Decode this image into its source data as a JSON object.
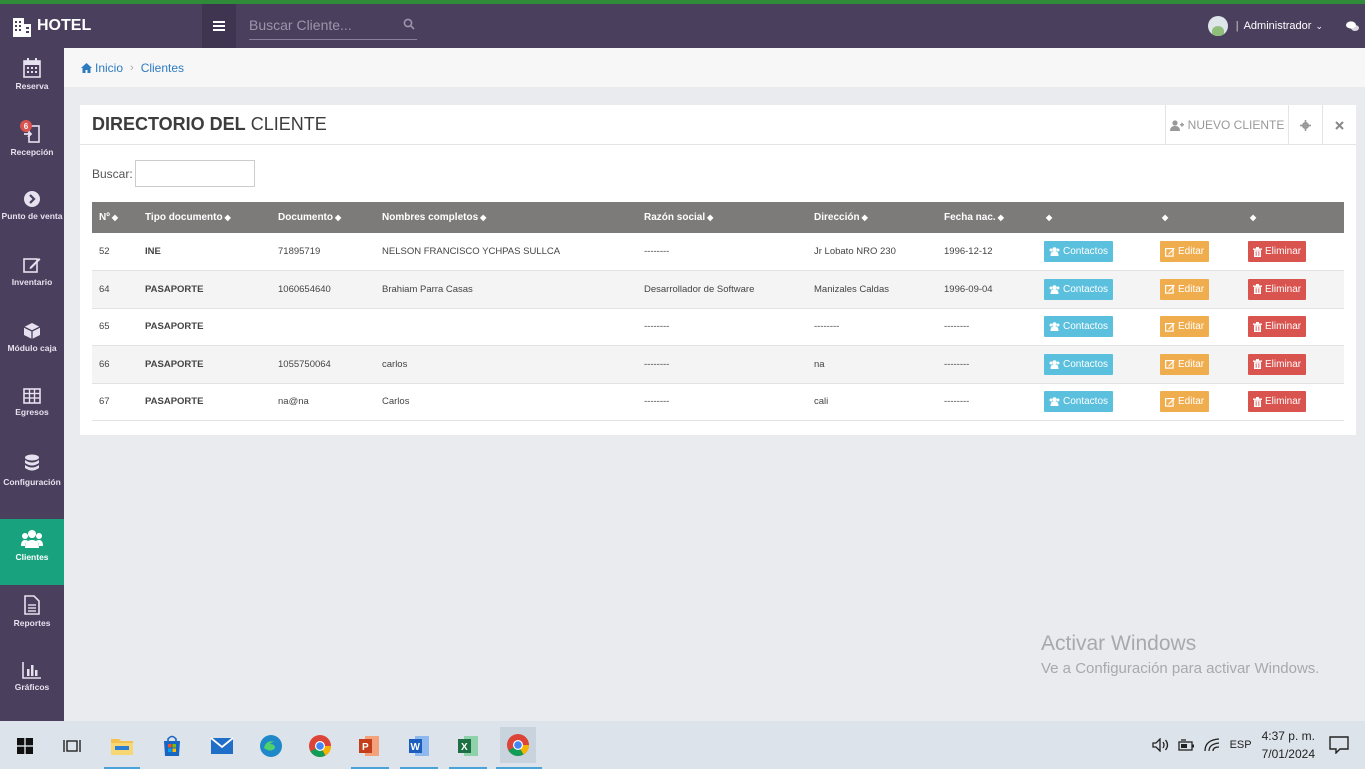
{
  "app": {
    "brand": "HOTEL"
  },
  "topbar": {
    "search_placeholder": "Buscar Cliente...",
    "user_name": "Administrador"
  },
  "sidebar": {
    "items": [
      {
        "label": "Reserva",
        "icon": "calendar-icon"
      },
      {
        "label": "Recepción",
        "icon": "door-icon",
        "badge": "6"
      },
      {
        "label": "Punto de venta",
        "icon": "arrow-circle-icon"
      },
      {
        "label": "Inventario",
        "icon": "edit-icon"
      },
      {
        "label": "Módulo caja",
        "icon": "cube-icon"
      },
      {
        "label": "Egresos",
        "icon": "table-icon"
      },
      {
        "label": "Configuración",
        "icon": "database-icon"
      },
      {
        "label": "Clientes",
        "icon": "users-icon",
        "active": true
      },
      {
        "label": "Reportes",
        "icon": "file-icon"
      },
      {
        "label": "Gráficos",
        "icon": "bar-chart-icon"
      }
    ]
  },
  "breadcrumb": {
    "home": "Inicio",
    "current": "Clientes"
  },
  "panel": {
    "title_bold": "DIRECTORIO DEL",
    "title_rest": " CLIENTE",
    "new_button": "NUEVO CLIENTE",
    "search_label": "Buscar:"
  },
  "table": {
    "headers": [
      "Nº",
      "Tipo documento",
      "Documento",
      "Nombres completos",
      "Razón social",
      "Dirección",
      "Fecha nac.",
      "",
      "",
      ""
    ],
    "rows": [
      {
        "n": "52",
        "tipo": "INE",
        "doc": "71895719",
        "nombre": "NELSON FRANCISCO YCHPAS SULLCA",
        "razon": "--------",
        "dir": "Jr Lobato NRO 230",
        "fecha": "1996-12-12"
      },
      {
        "n": "64",
        "tipo": "PASAPORTE",
        "doc": "1060654640",
        "nombre": "Brahiam Parra Casas",
        "razon": "Desarrollador de Software",
        "dir": "Manizales Caldas",
        "fecha": "1996-09-04"
      },
      {
        "n": "65",
        "tipo": "PASAPORTE",
        "doc": "",
        "nombre": "",
        "razon": "--------",
        "dir": "--------",
        "fecha": "--------"
      },
      {
        "n": "66",
        "tipo": "PASAPORTE",
        "doc": "1055750064",
        "nombre": "carlos",
        "razon": "--------",
        "dir": "na",
        "fecha": "--------"
      },
      {
        "n": "67",
        "tipo": "PASAPORTE",
        "doc": "na@na",
        "nombre": "Carlos",
        "razon": "--------",
        "dir": "cali",
        "fecha": "--------"
      }
    ],
    "btn_contact": "Contactos",
    "btn_edit": "Editar",
    "btn_delete": "Eliminar"
  },
  "watermark": {
    "line1": "Activar Windows",
    "line2": "Ve a Configuración para activar Windows."
  },
  "taskbar": {
    "lang": "ESP",
    "time": "4:37 p. m.",
    "date": "7/01/2024"
  }
}
